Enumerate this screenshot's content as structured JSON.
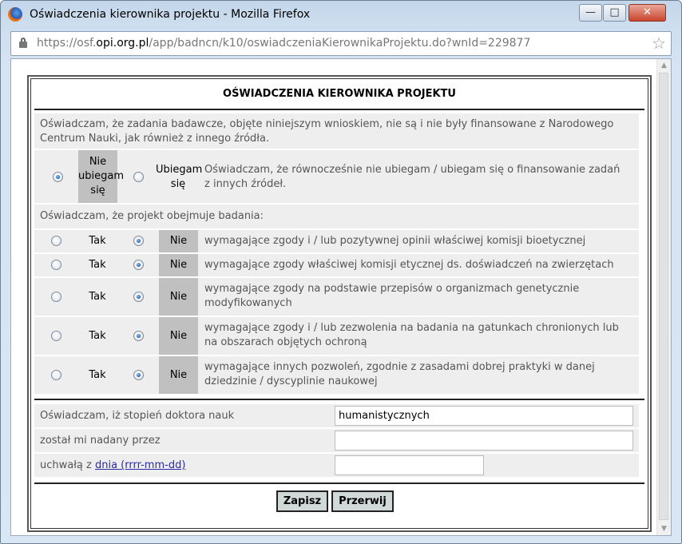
{
  "window": {
    "title": "Oświadczenia kierownika projektu - Mozilla Firefox",
    "minimize_icon": "minimize-icon",
    "maximize_icon": "maximize-icon",
    "close_icon": "close-icon"
  },
  "urlbar": {
    "prefix": "https://osf.",
    "domain": "opi.org.pl",
    "path": "/app/badncn/k10/oswiadczeniaKierownikaProjektu.do?wnId=229877"
  },
  "form": {
    "header": "OŚWIADCZENIA KIEROWNIKA PROJEKTU",
    "intro": "Oświadczam, że zadania badawcze, objęte niniejszym wnioskiem, nie są i nie były finansowane z Narodowego Centrum Nauki, jak również z innego źródła.",
    "funding": {
      "option_no": "Nie ubiegam się",
      "option_yes": "Ubiegam się",
      "selected": "no",
      "text": "Oświadczam, że równocześnie nie ubiegam / ubiegam się o finansowanie zadań z innych źródeł."
    },
    "research_intro": "Oświadczam, że projekt obejmuje badania:",
    "yes_label": "Tak",
    "no_label": "Nie",
    "research_rows": [
      {
        "text": "wymagające zgody i / lub pozytywnej opinii właściwej komisji bioetycznej",
        "selected": "no"
      },
      {
        "text": "wymagające zgody właściwej komisji etycznej ds. doświadczeń na zwierzętach",
        "selected": "no"
      },
      {
        "text": "wymagające zgody na podstawie przepisów o organizmach genetycznie modyfikowanych",
        "selected": "no"
      },
      {
        "text": "wymagające zgody i / lub zezwolenia na badania na gatunkach chronionych lub na obszarach objętych ochroną",
        "selected": "no"
      },
      {
        "text": "wymagające innych pozwoleń, zgodnie z zasadami dobrej praktyki w danej dziedzinie / dyscyplinie naukowej",
        "selected": "no"
      }
    ],
    "degree_label": "Oświadczam, iż stopień doktora nauk",
    "degree_value": "humanistycznych",
    "granted_by_label": "został mi nadany przez",
    "granted_by_value": "",
    "resolution_label_prefix": "uchwałą z ",
    "resolution_link": "dnia (rrrr-mm-dd)",
    "resolution_value": "",
    "save_label": "Zapisz",
    "cancel_label": "Przerwij"
  }
}
